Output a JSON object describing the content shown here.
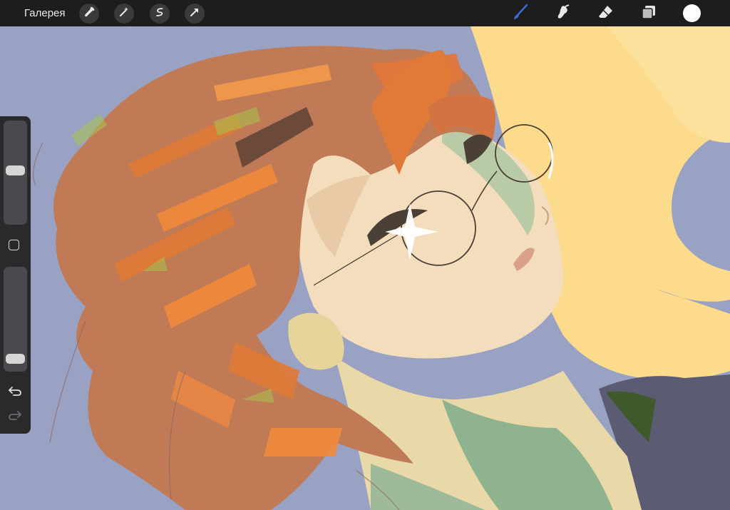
{
  "topbar": {
    "gallery_label": "Галерея",
    "actions": [
      {
        "name": "wrench-icon"
      },
      {
        "name": "magic-wand-icon"
      },
      {
        "name": "selection-icon"
      },
      {
        "name": "transform-arrow-icon"
      }
    ],
    "tools": [
      {
        "name": "brush-icon",
        "active": true
      },
      {
        "name": "smudge-icon",
        "active": false
      },
      {
        "name": "eraser-icon",
        "active": false
      },
      {
        "name": "layers-icon",
        "active": false
      }
    ],
    "current_color": "#ffffff",
    "active_tool_color": "#3a6fd8"
  },
  "sidebar": {
    "brush_size_level": 0.52,
    "opacity_level": 0.06,
    "modifier_icon": "modifier-square-icon",
    "undo_icon": "undo-icon",
    "redo_icon": "redo-icon"
  },
  "canvas": {
    "background_color": "#9aa2c4",
    "highlight_color": "#fcdc8c",
    "hair_color": "#e07a38",
    "skin_color": "#f3ddbc"
  }
}
